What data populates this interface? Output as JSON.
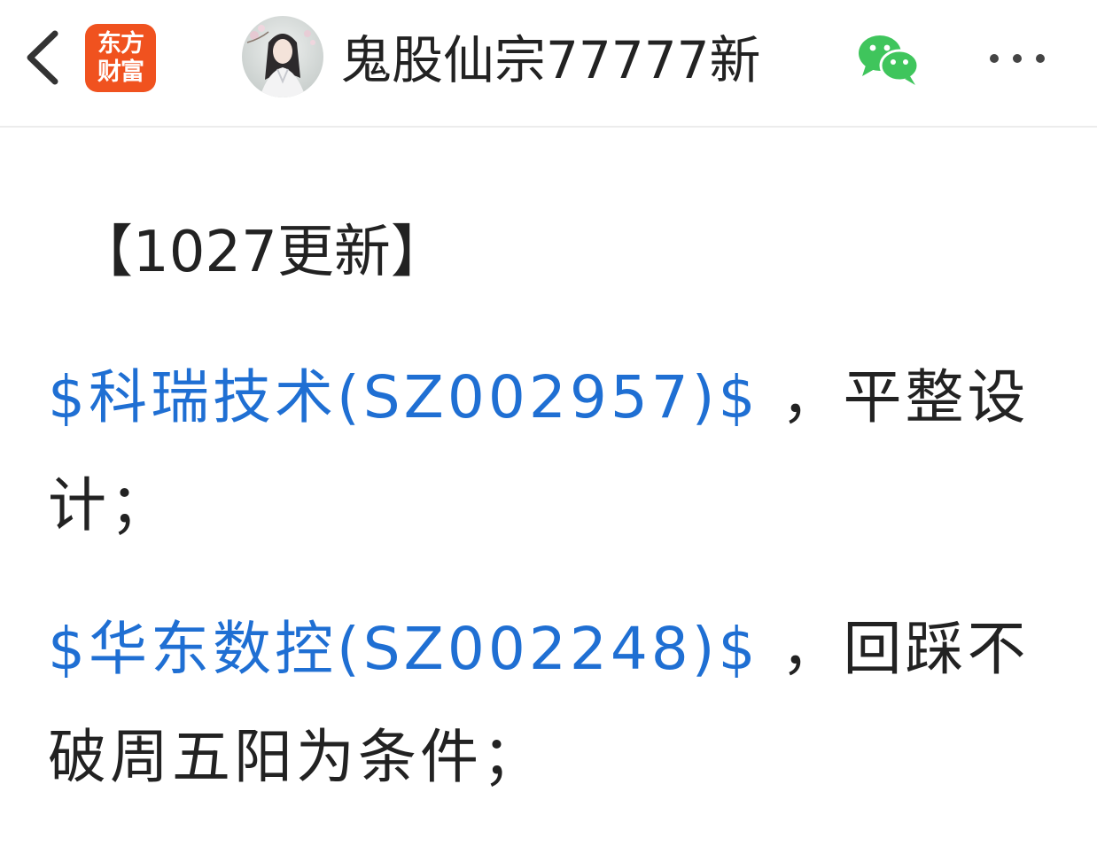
{
  "header": {
    "app_logo_line1": "东方",
    "app_logo_line2": "财富",
    "author_name": "鬼股仙宗77777新",
    "icons": {
      "back": "chevron-left-icon",
      "wechat": "wechat-icon",
      "more": "more-dots-icon"
    },
    "colors": {
      "logo_bg": "#f0521f",
      "wechat_green": "#3fc55c",
      "link_blue": "#1f6fd3"
    }
  },
  "post": {
    "title": "【1027更新】",
    "items": [
      {
        "stock_link": "$科瑞技术(SZ002957)$",
        "comment": " ，平整设计；"
      },
      {
        "stock_link": "$华东数控(SZ002248)$",
        "comment": " ，回踩不破周五阳为条件；"
      }
    ]
  }
}
